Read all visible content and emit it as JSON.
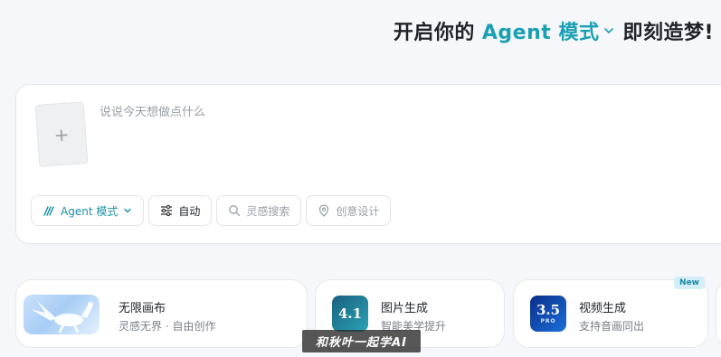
{
  "headline": {
    "prefix": "开启你的",
    "agent_label": "Agent 模式",
    "suffix": "即刻造梦!"
  },
  "composer": {
    "prompt_placeholder": "说说今天想做点什么",
    "upload_symbol": "+"
  },
  "chips": {
    "agent_mode": "Agent 模式",
    "auto": "自动",
    "inspiration_search": "灵感搜索",
    "creative_design": "创意设计"
  },
  "cards": [
    {
      "title": "无限画布",
      "subtitle": "灵感无界 · 自由创作"
    },
    {
      "title": "图片生成",
      "subtitle": "智能美学提升",
      "thumb_text": "4.1"
    },
    {
      "title": "视频生成",
      "subtitle": "支持音画同出",
      "thumb_text": "3.5",
      "thumb_sub": "PRO",
      "badge": "New"
    }
  ],
  "watermark": "和秋叶一起学AI",
  "colors": {
    "accent": "#1aa0b4",
    "background": "#f5f7fa"
  }
}
